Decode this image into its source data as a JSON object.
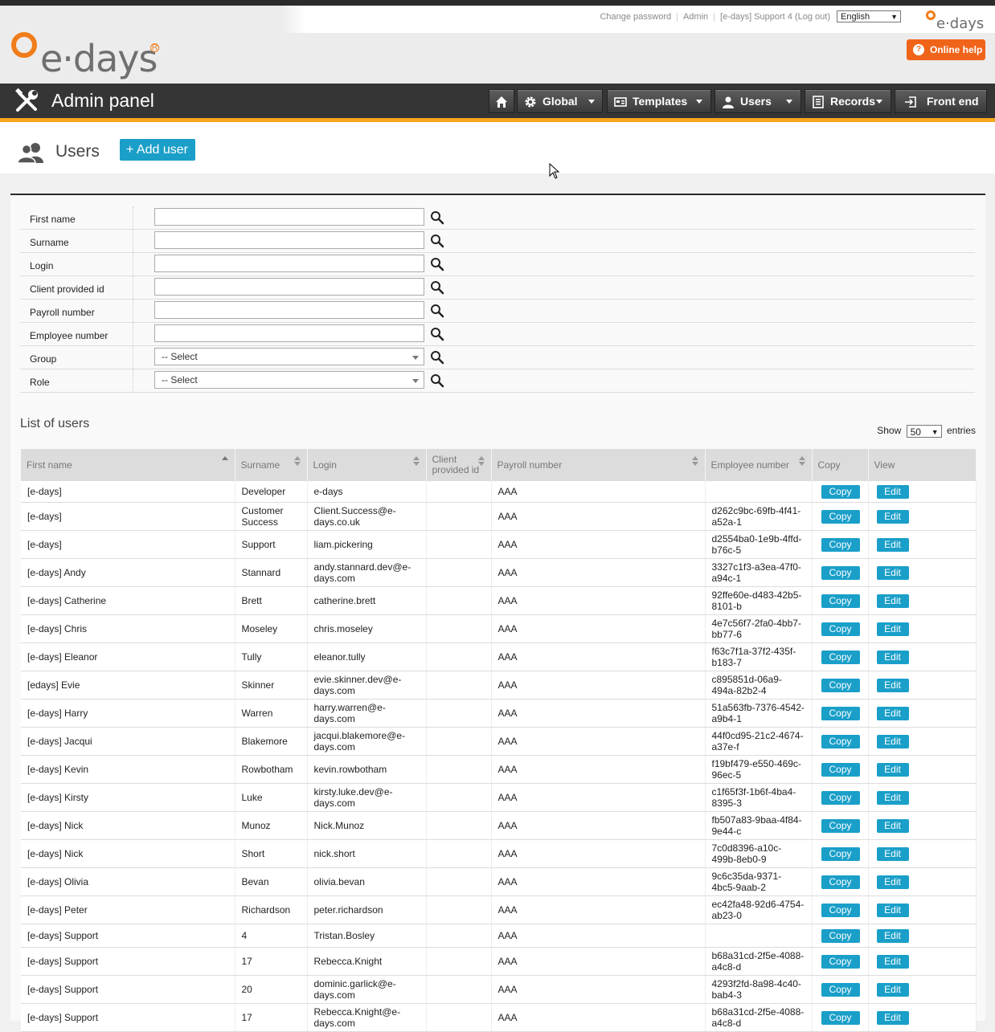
{
  "topbar": {
    "change_password": "Change password",
    "admin": "Admin",
    "user_label": "[e-days] Support 4",
    "logout": "(Log out)",
    "language": "English"
  },
  "logo_small": "e·days",
  "logo_big": "e·days",
  "online_help": "Online help",
  "nav": {
    "title": "Admin panel",
    "global": "Global",
    "templates": "Templates",
    "users": "Users",
    "records": "Records",
    "front_end": "Front end"
  },
  "page": {
    "title": "Users",
    "add_user": "+ Add user"
  },
  "filters": {
    "first_name": "First name",
    "surname": "Surname",
    "login": "Login",
    "client_provided_id": "Client provided id",
    "payroll_number": "Payroll number",
    "employee_number": "Employee number",
    "group": "Group",
    "group_value": "-- Select",
    "role": "Role",
    "role_value": "-- Select"
  },
  "list": {
    "title": "List of users",
    "show": "Show",
    "entries_value": "50",
    "entries": "entries"
  },
  "table": {
    "headers": [
      "First name",
      "Surname",
      "Login",
      "Client provided id",
      "Payroll number",
      "Employee number",
      "Copy",
      "View"
    ],
    "copy_label": "Copy",
    "edit_label": "Edit",
    "rows": [
      {
        "first": "[e-days]",
        "surname": "Developer",
        "login": "e-days",
        "client": "",
        "payroll": "AAA",
        "employee": ""
      },
      {
        "first": "[e-days]",
        "surname": "Customer Success",
        "login": "Client.Success@e-days.co.uk",
        "client": "",
        "payroll": "AAA",
        "employee": "d262c9bc-69fb-4f41-a52a-1"
      },
      {
        "first": "[e-days]",
        "surname": "Support",
        "login": "liam.pickering",
        "client": "",
        "payroll": "AAA",
        "employee": "d2554ba0-1e9b-4ffd-b76c-5"
      },
      {
        "first": "[e-days] Andy",
        "surname": "Stannard",
        "login": "andy.stannard.dev@e-days.com",
        "client": "",
        "payroll": "AAA",
        "employee": "3327c1f3-a3ea-47f0-a94c-1"
      },
      {
        "first": "[e-days] Catherine",
        "surname": "Brett",
        "login": "catherine.brett",
        "client": "",
        "payroll": "AAA",
        "employee": "92ffe60e-d483-42b5-8101-b"
      },
      {
        "first": "[e-days] Chris",
        "surname": "Moseley",
        "login": "chris.moseley",
        "client": "",
        "payroll": "AAA",
        "employee": "4e7c56f7-2fa0-4bb7-bb77-6"
      },
      {
        "first": "[e-days] Eleanor",
        "surname": "Tully",
        "login": "eleanor.tully",
        "client": "",
        "payroll": "AAA",
        "employee": "f63c7f1a-37f2-435f-b183-7"
      },
      {
        "first": "[edays] Evie",
        "surname": "Skinner",
        "login": "evie.skinner.dev@e-days.com",
        "client": "",
        "payroll": "AAA",
        "employee": "c895851d-06a9-494a-82b2-4"
      },
      {
        "first": "[e-days] Harry",
        "surname": "Warren",
        "login": "harry.warren@e-days.com",
        "client": "",
        "payroll": "AAA",
        "employee": "51a563fb-7376-4542-a9b4-1"
      },
      {
        "first": "[e-days] Jacqui",
        "surname": "Blakemore",
        "login": "jacqui.blakemore@e-days.com",
        "client": "",
        "payroll": "AAA",
        "employee": "44f0cd95-21c2-4674-a37e-f"
      },
      {
        "first": "[e-days] Kevin",
        "surname": "Rowbotham",
        "login": "kevin.rowbotham",
        "client": "",
        "payroll": "AAA",
        "employee": "f19bf479-e550-469c-96ec-5"
      },
      {
        "first": "[e-days] Kirsty",
        "surname": "Luke",
        "login": "kirsty.luke.dev@e-days.com",
        "client": "",
        "payroll": "AAA",
        "employee": "c1f65f3f-1b6f-4ba4-8395-3"
      },
      {
        "first": "[e-days] Nick",
        "surname": "Munoz",
        "login": "Nick.Munoz",
        "client": "",
        "payroll": "AAA",
        "employee": "fb507a83-9baa-4f84-9e44-c"
      },
      {
        "first": "[e-days] Nick",
        "surname": "Short",
        "login": "nick.short",
        "client": "",
        "payroll": "AAA",
        "employee": "7c0d8396-a10c-499b-8eb0-9"
      },
      {
        "first": "[e-days] Olivia",
        "surname": "Bevan",
        "login": "olivia.bevan",
        "client": "",
        "payroll": "AAA",
        "employee": "9c6c35da-9371-4bc5-9aab-2"
      },
      {
        "first": "[e-days] Peter",
        "surname": "Richardson",
        "login": "peter.richardson",
        "client": "",
        "payroll": "AAA",
        "employee": "ec42fa48-92d6-4754-ab23-0"
      },
      {
        "first": "[e-days] Support",
        "surname": "4",
        "login": "Tristan.Bosley",
        "client": "",
        "payroll": "AAA",
        "employee": ""
      },
      {
        "first": "[e-days] Support",
        "surname": "17",
        "login": "Rebecca.Knight",
        "client": "",
        "payroll": "AAA",
        "employee": "b68a31cd-2f5e-4088-a4c8-d"
      },
      {
        "first": "[e-days] Support",
        "surname": "20",
        "login": "dominic.garlick@e-days.com",
        "client": "",
        "payroll": "AAA",
        "employee": "4293f2fd-8a98-4c40-bab4-3"
      },
      {
        "first": "[e-days] Support",
        "surname": "17",
        "login": "Rebecca.Knight@e-days.com",
        "client": "",
        "payroll": "AAA",
        "employee": "b68a31cd-2f5e-4088-a4c8-d"
      }
    ]
  },
  "colors": {
    "brand_orange": "#f07d1a",
    "accent_blue": "#1a9fc9",
    "nav_dark": "#353535",
    "nav_line": "#f7a51d",
    "help_orange": "#f06419"
  }
}
